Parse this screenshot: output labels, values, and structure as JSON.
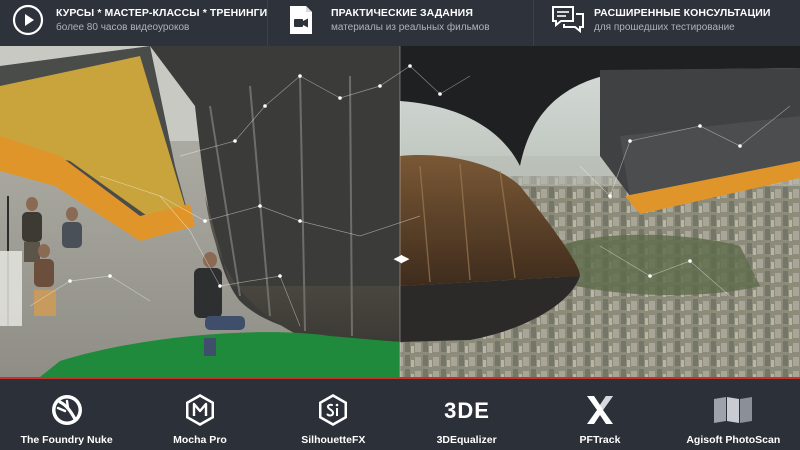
{
  "features": [
    {
      "icon": "play-circle-icon",
      "title": "КУРСЫ * МАСТЕР-КЛАССЫ * ТРЕНИНГИ",
      "subtitle": "более 80 часов видеоуроков"
    },
    {
      "icon": "film-camera-icon",
      "title": "ПРАКТИЧЕСКИЕ ЗАДАНИЯ",
      "subtitle": "материалы из реальных фильмов"
    },
    {
      "icon": "chat-bubbles-icon",
      "title": "РАСШИРЕННЫЕ КОНСУЛЬТАЦИИ",
      "subtitle": "для прошедших тестирование"
    }
  ],
  "hero": {
    "divider_glyph": "◀▶",
    "prev_glyph": "‹",
    "next_glyph": "›"
  },
  "software": [
    {
      "icon": "nuke-logo-icon",
      "label": "The Foundry Nuke"
    },
    {
      "icon": "mocha-logo-icon",
      "label": "Mocha Pro"
    },
    {
      "icon": "silhouette-logo-icon",
      "label": "SilhouetteFX"
    },
    {
      "icon": "3dequalizer-logo-icon",
      "label": "3DEqualizer",
      "logo_text": "3DE"
    },
    {
      "icon": "pftrack-logo-icon",
      "label": "PFTrack"
    },
    {
      "icon": "photoscan-logo-icon",
      "label": "Agisoft PhotoScan"
    }
  ],
  "colors": {
    "bar_bg": "#2d323b",
    "accent_red": "#c8312c",
    "sub_text": "#aeb3bb"
  }
}
